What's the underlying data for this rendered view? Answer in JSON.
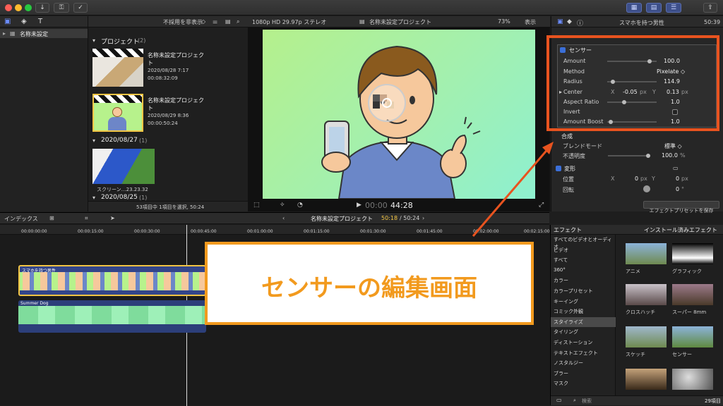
{
  "toolbar": {
    "download_icon": "download-icon",
    "key_icon": "key-icon",
    "check_icon": "check-circle-icon",
    "share_icon": "share-icon"
  },
  "browser": {
    "library_name": "名称未設定",
    "filter": "不採用を非表示",
    "section_project": "プロジェクト",
    "section_project_count": "(2)",
    "items": [
      {
        "title": "名称未設定プロジェク\nト",
        "date": "2020/08/28 7:17",
        "duration": "00:08:32:09"
      },
      {
        "title": "名称未設定プロジェク\nト",
        "date": "2020/08/29 8:36",
        "duration": "00:00:50:24"
      }
    ],
    "section_date": "2020/08/27",
    "section_date_count": "(1)",
    "clip_name": "スクリーン…23.23.32",
    "section_date2": "2020/08/25",
    "section_date2_count": "(1)",
    "status": "53項目中 1項目を選択, 50:24"
  },
  "viewer": {
    "format": "1080p HD 29.97p ステレオ",
    "project": "名称未設定プロジェクト",
    "zoom": "73%",
    "view": "表示",
    "timecode": "00:00",
    "timecode_main": "44:28"
  },
  "inspector": {
    "title": "スマホを持つ男性",
    "duration": "50:39",
    "effect_name": "センサー",
    "params": [
      {
        "label": "Amount",
        "value": "100.0",
        "level": 0.82
      },
      {
        "label": "Method",
        "value": "Pixelate ◇"
      },
      {
        "label": "Radius",
        "value": "114.9",
        "level": 0.08
      },
      {
        "label": "Center",
        "x_label": "X",
        "x_value": "-0.05",
        "x_unit": "px",
        "y_label": "Y",
        "y_value": "0.13",
        "y_unit": "px"
      },
      {
        "label": "Aspect Ratio",
        "value": "1.0",
        "level": 0.3
      },
      {
        "label": "Invert",
        "value": ""
      },
      {
        "label": "Amount Boost",
        "value": "1.0",
        "level": 0.03
      }
    ],
    "composite": "合成",
    "blend_label": "ブレンドモード",
    "blend_value": "標準 ◇",
    "opacity_label": "不透明度",
    "opacity_value": "100.0",
    "opacity_unit": "%",
    "transform": "変形",
    "position_label": "位置",
    "pos_x": "0",
    "pos_y": "0",
    "px": "px",
    "rotation_label": "回転",
    "rotation_value": "0",
    "rotation_unit": "°",
    "save_preset": "エフェクトプリセットを保存"
  },
  "timeline": {
    "index": "インデックス",
    "project": "名称未設定プロジェクト",
    "position": "50:18",
    "total": "/ 50:24",
    "ruler": [
      "00:00:00:00",
      "00:00:15:00",
      "00:00:30:00",
      "00:00:45:00",
      "00:01:00:00",
      "00:01:15:00",
      "00:01:30:00",
      "00:01:45:00",
      "00:02:00:00",
      "00:02:15:00"
    ],
    "clip_title": "スマホを持つ男性",
    "audio_title": "Summer Dog"
  },
  "effects": {
    "header": "エフェクト",
    "installed": "インストール済みエフェクト",
    "categories": [
      "すべてのビデオとオーディオ",
      "ビデオ",
      "すべて",
      "360°",
      "カラー",
      "カラープリセット",
      "キーイング",
      "コミック外観",
      "スタイライズ",
      "タイリング",
      "ディストーション",
      "テキストエフェクト",
      "ノスタルジー",
      "ブラー",
      "マスク"
    ],
    "selected_category": "スタイライズ",
    "thumbs": [
      {
        "name": "アニメ"
      },
      {
        "name": "グラフィック"
      },
      {
        "name": "クロスハッチ"
      },
      {
        "name": "スーパー 8mm"
      },
      {
        "name": "スケッチ"
      },
      {
        "name": "センサー"
      },
      {
        "name": ""
      },
      {
        "name": ""
      }
    ],
    "search_placeholder": "検索",
    "count": "29項目"
  },
  "callout": {
    "text": "センサーの編集画面"
  },
  "colors": {
    "accent": "#e8531f",
    "callout_text": "#f29a1e",
    "selection": "#f2c544",
    "green_bg": "#b7f28c",
    "mint": "#93f0c8"
  }
}
